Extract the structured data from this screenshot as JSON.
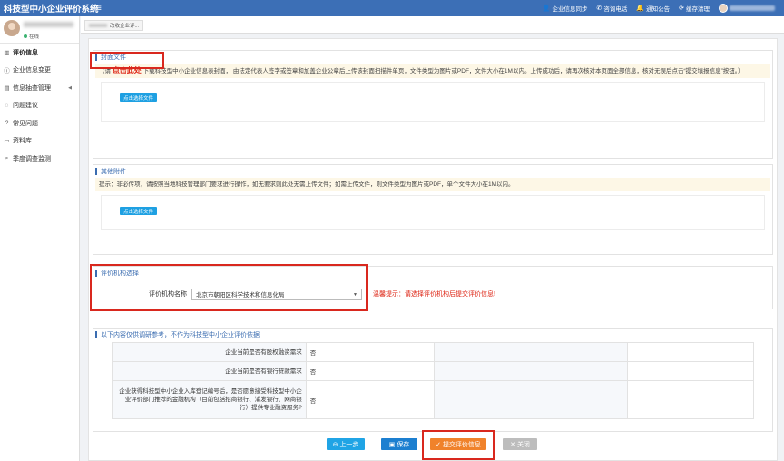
{
  "header": {
    "title": "科技型中小企业评价系统",
    "actions": [
      {
        "icon": "user-icon",
        "label": "企业信息同步"
      },
      {
        "icon": "phone-icon",
        "label": "咨询电话"
      },
      {
        "icon": "bell-icon",
        "label": "通知公告"
      },
      {
        "icon": "refresh-icon",
        "label": "缓存清理"
      }
    ]
  },
  "sidebar": {
    "status": "在线",
    "items": [
      {
        "icon": "chart-icon",
        "label": "评价信息"
      },
      {
        "icon": "info-icon",
        "label": "企业信息变更"
      },
      {
        "icon": "folder-icon",
        "label": "信息抽查管理"
      },
      {
        "icon": "comment-icon",
        "label": "问题建议"
      },
      {
        "icon": "question-icon",
        "label": "常见问题"
      },
      {
        "icon": "folder-open-icon",
        "label": "资料库"
      },
      {
        "icon": "search-icon",
        "label": "季度调查监测"
      }
    ]
  },
  "tabs": {
    "active_suffix": "改收企业评..."
  },
  "cover": {
    "title": "封面文件",
    "notice_pre": "（请 ",
    "notice_link": "点击此处",
    "notice_post": " 下载科技型中小企业信息表封面， 由法定代表人签字或签章和加盖企业公章后上传该封面扫描件单页，文件类型为图片或PDF，文件大小在1M以内。上传成功后，请再次核对本页面全部信息，核对无误后点击“提交填报信息”按钮。）",
    "button": "点击选择文件"
  },
  "attachments": {
    "title": "其他附件",
    "notice": "提示：非必传项，请按照当地科技管理部门要求进行操作，如无要求则此处无需上传文件；如需上传文件，则文件类型为图片或PDF，单个文件大小在1M以内。",
    "button": "点击选择文件"
  },
  "org": {
    "title": "评价机构选择",
    "label": "评价机构名称",
    "selected": "北京市朝阳区科学技术和信息化局",
    "warning": "温馨提示：请选择评价机构后提交评价信息!"
  },
  "survey": {
    "title": "以下内容仅供调研参考，不作为科技型中小企业评价依据",
    "rows": [
      {
        "question": "企业当前是否有股权融资需求",
        "answer": "否"
      },
      {
        "question": "企业当前是否有银行贷款需求",
        "answer": "否"
      },
      {
        "question": "企业获得科技型中小企业入库登记编号后，是否愿意接受科技型中小企业评价部门推荐的金融机构（目前包括招商银行、浦发银行、网商银行）提供专业融资服务?",
        "answer": "否"
      }
    ]
  },
  "buttons": {
    "prev": "上一步",
    "save": "保存",
    "submit": "提交评价信息",
    "close": "关闭"
  },
  "colors": {
    "header_bg": "#3c6fb6",
    "accent": "#3a6cb0",
    "highlight": "#d9281e",
    "submit": "#f0822b"
  }
}
